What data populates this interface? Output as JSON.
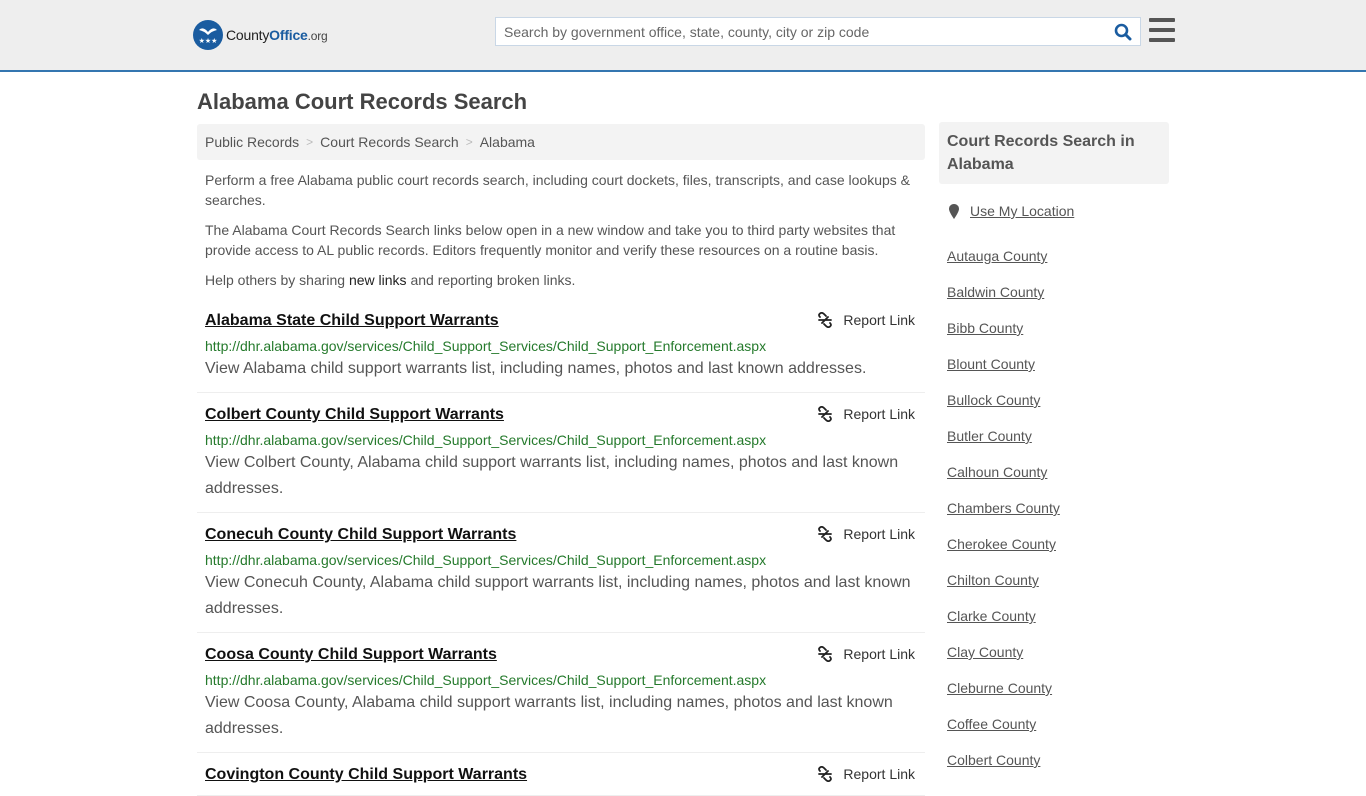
{
  "header": {
    "logo": {
      "name": "County",
      "office": "Office",
      "tld": ".org"
    },
    "search_placeholder": "Search by government office, state, county, city or zip code",
    "search_value": "",
    "accent_color": "#3476b0"
  },
  "page": {
    "title": "Alabama Court Records Search",
    "breadcrumb": [
      "Public Records",
      "Court Records Search",
      "Alabama"
    ],
    "intro": {
      "p1": "Perform a free Alabama public court records search, including court dockets, files, transcripts, and case lookups & searches.",
      "p2": "The Alabama Court Records Search links below open in a new window and take you to third party websites that provide access to AL public records. Editors frequently monitor and verify these resources on a routine basis.",
      "p3_before": "Help others by sharing ",
      "p3_link": "new links",
      "p3_after": " and reporting broken links."
    }
  },
  "results": [
    {
      "title": "Alabama State Child Support Warrants",
      "url": "http://dhr.alabama.gov/services/Child_Support_Services/Child_Support_Enforcement.aspx",
      "description": "View Alabama child support warrants list, including names, photos and last known addresses.",
      "report_label": "Report Link"
    },
    {
      "title": "Colbert County Child Support Warrants",
      "url": "http://dhr.alabama.gov/services/Child_Support_Services/Child_Support_Enforcement.aspx",
      "description": "View Colbert County, Alabama child support warrants list, including names, photos and last known addresses.",
      "report_label": "Report Link"
    },
    {
      "title": "Conecuh County Child Support Warrants",
      "url": "http://dhr.alabama.gov/services/Child_Support_Services/Child_Support_Enforcement.aspx",
      "description": "View Conecuh County, Alabama child support warrants list, including names, photos and last known addresses.",
      "report_label": "Report Link"
    },
    {
      "title": "Coosa County Child Support Warrants",
      "url": "http://dhr.alabama.gov/services/Child_Support_Services/Child_Support_Enforcement.aspx",
      "description": "View Coosa County, Alabama child support warrants list, including names, photos and last known addresses.",
      "report_label": "Report Link"
    },
    {
      "title": "Covington County Child Support Warrants",
      "url": "",
      "description": "",
      "report_label": "Report Link"
    }
  ],
  "sidebar": {
    "heading": "Court Records Search in Alabama",
    "use_location": "Use My Location",
    "counties": [
      "Autauga County",
      "Baldwin County",
      "Bibb County",
      "Blount County",
      "Bullock County",
      "Butler County",
      "Calhoun County",
      "Chambers County",
      "Cherokee County",
      "Chilton County",
      "Clarke County",
      "Clay County",
      "Cleburne County",
      "Coffee County",
      "Colbert County"
    ]
  }
}
